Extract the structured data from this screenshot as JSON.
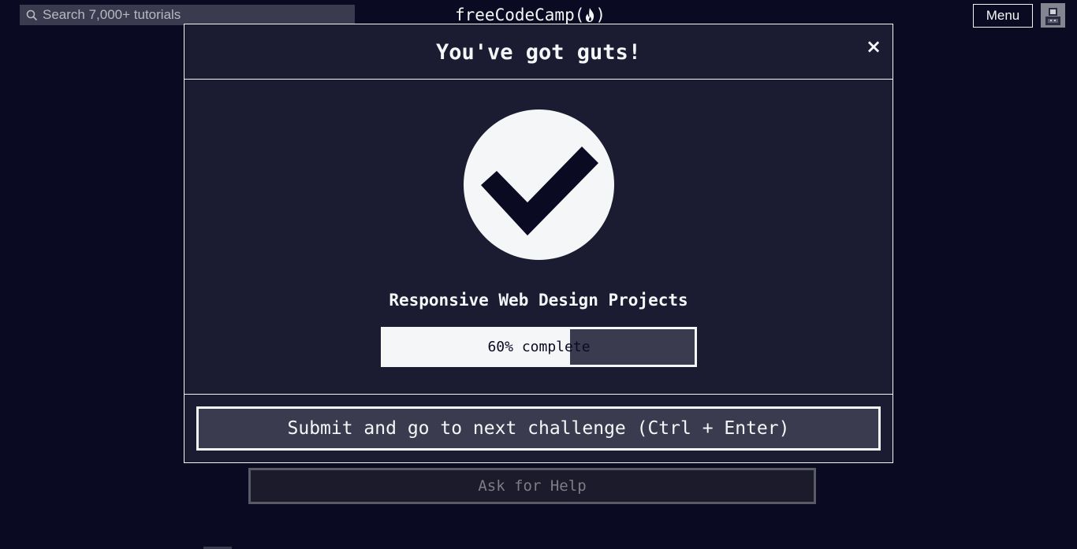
{
  "navbar": {
    "search_placeholder": "Search 7,000+ tutorials",
    "logo_text": "freeCodeCamp",
    "menu_label": "Menu"
  },
  "page": {
    "help_label": "Ask for Help"
  },
  "modal": {
    "title": "You've got guts!",
    "close_label": "×",
    "superblock": "Responsive Web Design Projects",
    "progress": {
      "percent": 60,
      "label_start": "60% compl",
      "label_end": "ete"
    },
    "submit_label": "Submit and go to next challenge (Ctrl + Enter)"
  },
  "colors": {
    "background": "#0a0a23",
    "modal_background": "#1b1b32",
    "border": "#f5f6f7",
    "button_background": "#3b3b4f"
  }
}
